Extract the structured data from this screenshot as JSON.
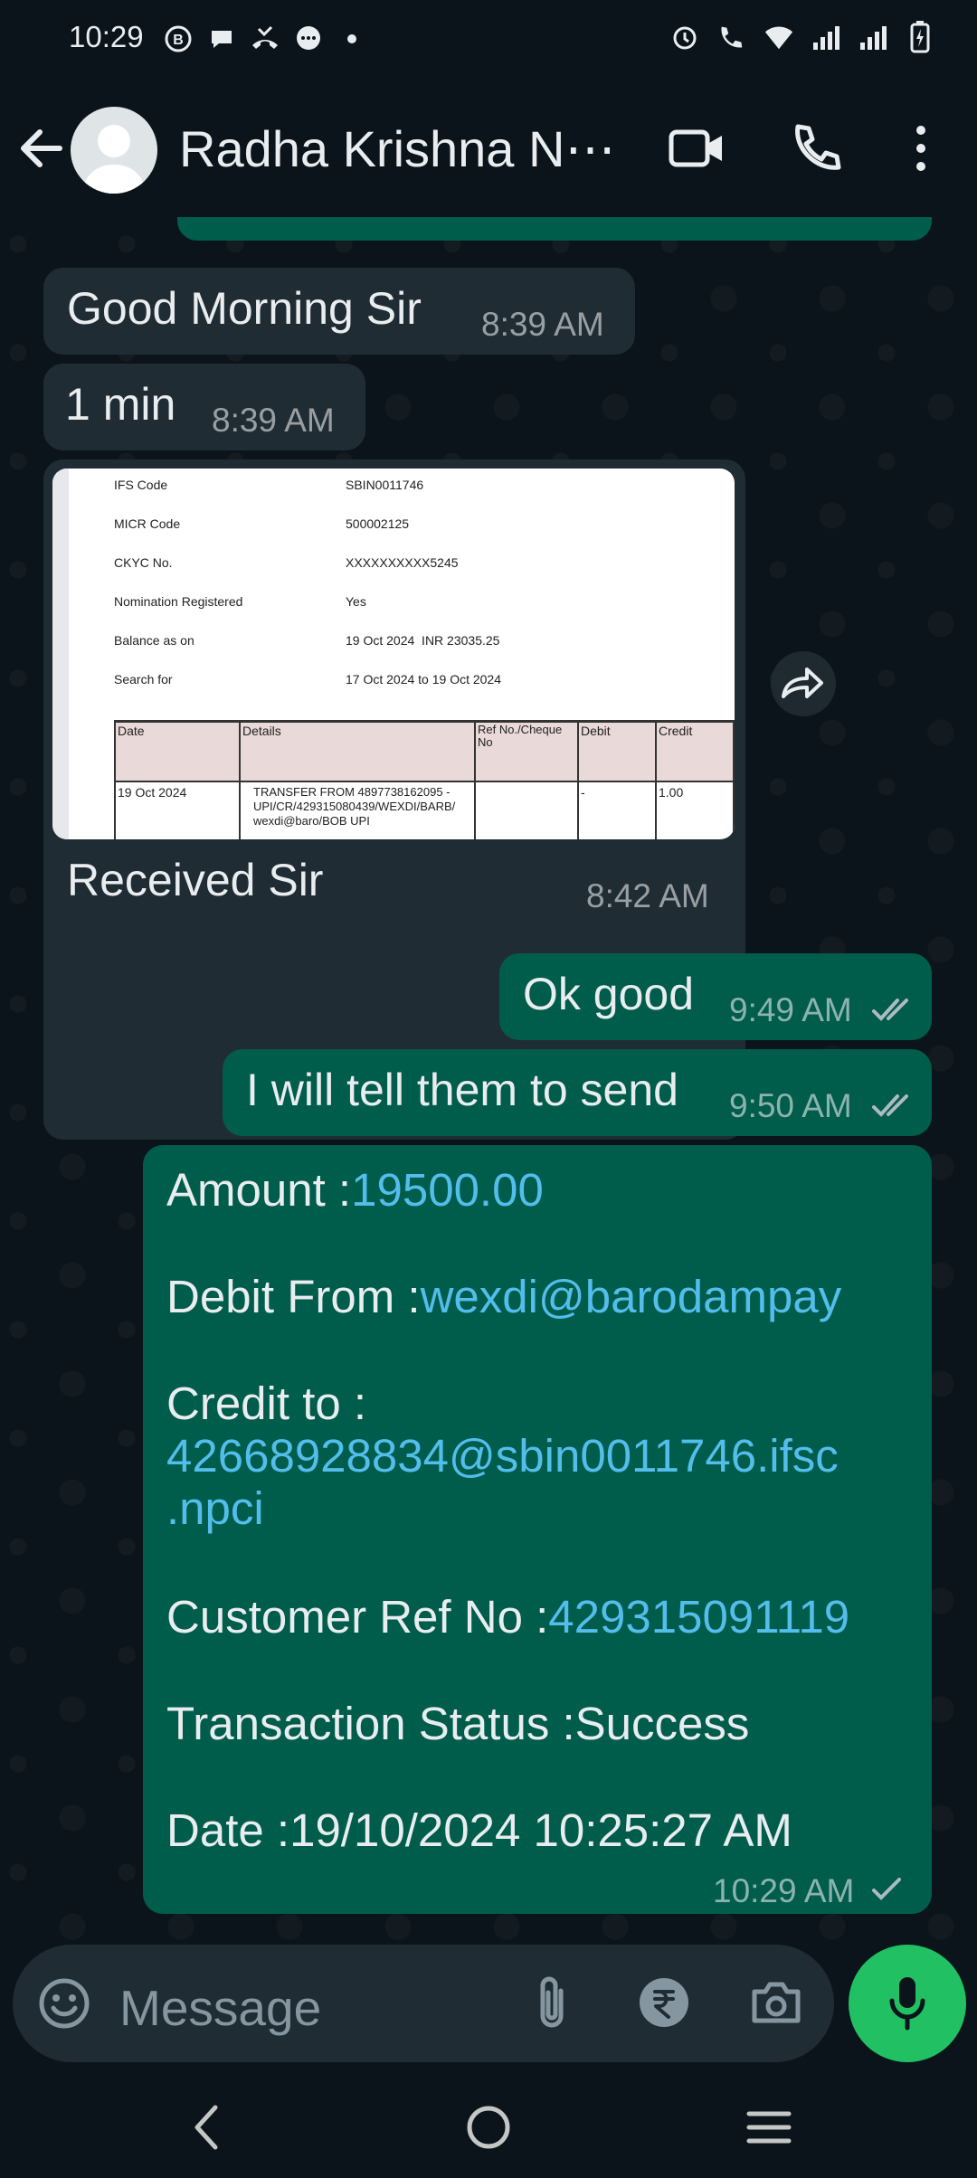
{
  "status_bar": {
    "time": "10:29",
    "left_icons": [
      "b-icon",
      "chat-icon",
      "missed-call-icon",
      "messenger-icon",
      "dot-icon"
    ],
    "right_icons": [
      "alarm-icon",
      "wifi-call-icon",
      "wifi-icon",
      "signal-icon",
      "signal-icon",
      "battery-charging-icon"
    ]
  },
  "header": {
    "contact_name": "Radha Krishna N⋯",
    "icons": [
      "back-arrow-icon",
      "avatar-icon",
      "video-call-icon",
      "phone-icon",
      "more-vert-icon"
    ]
  },
  "messages": [
    {
      "dir": "in",
      "text": "Good Morning Sir",
      "time": "8:39 AM"
    },
    {
      "dir": "in",
      "text": "1 min",
      "time": "8:39 AM"
    },
    {
      "dir": "in",
      "caption": "Received Sir",
      "time": "8:42 AM"
    },
    {
      "dir": "out",
      "text": "Ok good",
      "time": "9:49 AM",
      "status": "read"
    },
    {
      "dir": "out",
      "text": "I will tell them to send",
      "time": "9:50 AM",
      "status": "read"
    }
  ],
  "image_doc": {
    "rows": [
      {
        "label": "IFS Code",
        "value": "SBIN0011746"
      },
      {
        "label": "MICR Code",
        "value": "500002125"
      },
      {
        "label": "CKYC No.",
        "value": "XXXXXXXXXX5245"
      },
      {
        "label": "Nomination Registered",
        "value": "Yes"
      },
      {
        "label": "Balance as on",
        "value": "19 Oct 2024  INR 23035.25"
      },
      {
        "label": "Search for",
        "value": "17 Oct 2024 to 19 Oct 2024"
      }
    ],
    "table_headers": [
      "Date",
      "Details",
      "Ref No./Cheque No",
      "Debit",
      "Credit"
    ],
    "table_row": {
      "date": "19 Oct 2024",
      "details_1": "TRANSFER FROM 4897738162095 -",
      "details_2": "UPI/CR/429315080439/WEXDI/BARB/",
      "details_3": "wexdi@baro/BOB UPI",
      "ref": "",
      "debit": "-",
      "credit": "1.00"
    }
  },
  "receipt": {
    "amount_label": "Amount :",
    "amount_value": "19500.00",
    "debit_label": "Debit From :",
    "debit_value": "wexdi@barodampay",
    "credit_label": "Credit to :",
    "credit_value_1": "42668928834@sbin0011746.ifsc",
    "credit_value_2": ".npci",
    "ref_label": "Customer Ref No :",
    "ref_value": "429315091119",
    "status_label": "Transaction Status :",
    "status_value": "Success",
    "date_label": "Date :",
    "date_value": "19/10/2024 10:25:27 AM",
    "time": "10:29 AM",
    "tick_status": "sent"
  },
  "input": {
    "placeholder": "Message"
  },
  "colors": {
    "background": "#0b141a",
    "incoming": "#202c33",
    "outgoing": "#005c4b",
    "link": "#53bdeb",
    "mic": "#21c063",
    "read_tick": "#53bdeb"
  }
}
